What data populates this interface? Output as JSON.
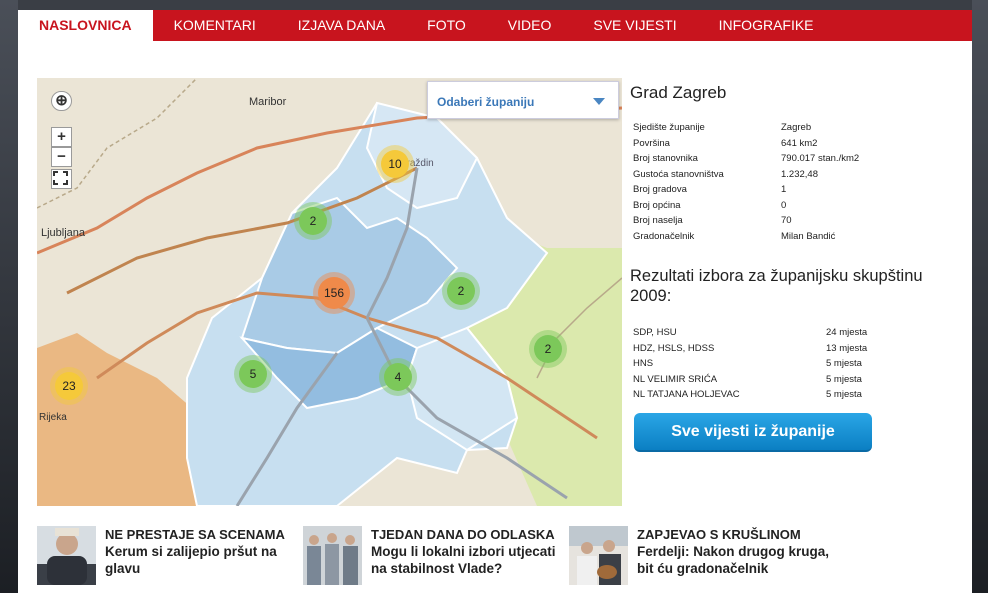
{
  "nav": {
    "tabs": [
      {
        "label": "NASLOVNICA",
        "active": true
      },
      {
        "label": "KOMENTARI"
      },
      {
        "label": "IZJAVA DANA"
      },
      {
        "label": "FOTO"
      },
      {
        "label": "VIDEO"
      },
      {
        "label": "SVE VIJESTI"
      },
      {
        "label": "INFOGRAFIKE"
      }
    ]
  },
  "map": {
    "select_placeholder": "Odaberi županiju",
    "controls": {
      "locate": "⊕",
      "zoom_in": "+",
      "zoom_out": "−"
    },
    "places": [
      "Maribor",
      "Ljubljana",
      "Rijeka",
      "Varaždin"
    ],
    "clusters": [
      {
        "count": "10",
        "color": "#f5c93a"
      },
      {
        "count": "2",
        "color": "#7cc85a"
      },
      {
        "count": "156",
        "color": "#ef8a4a"
      },
      {
        "count": "2",
        "color": "#7cc85a"
      },
      {
        "count": "5",
        "color": "#7cc85a"
      },
      {
        "count": "4",
        "color": "#7cc85a"
      },
      {
        "count": "2",
        "color": "#7cc85a"
      },
      {
        "count": "23",
        "color": "#f5c93a"
      }
    ]
  },
  "county": {
    "title": "Grad Zagreb",
    "facts": [
      {
        "label": "Sjedište županije",
        "value": "Zagreb"
      },
      {
        "label": "Površina",
        "value": "641 km2"
      },
      {
        "label": "Broj stanovnika",
        "value": "790.017 stan./km2"
      },
      {
        "label": "Gustoća stanovništva",
        "value": "1.232,48"
      },
      {
        "label": "Broj gradova",
        "value": "1"
      },
      {
        "label": "Broj općina",
        "value": "0"
      },
      {
        "label": "Broj naselja",
        "value": "70"
      },
      {
        "label": "Gradonačelnik",
        "value": "Milan Bandić"
      }
    ],
    "results_title": "Rezultati izbora za županijsku skupštinu 2009:",
    "results": [
      {
        "party": "SDP, HSU",
        "seats": "24 mjesta"
      },
      {
        "party": "HDZ, HSLS, HDSS",
        "seats": "13 mjesta"
      },
      {
        "party": "HNS",
        "seats": "5 mjesta"
      },
      {
        "party": "NL VELIMIR SRIĆA",
        "seats": "5 mjesta"
      },
      {
        "party": "NL TATJANA HOLJEVAC",
        "seats": "5 mjesta"
      }
    ],
    "news_button": "Sve vijesti iz županije"
  },
  "news": [
    {
      "kicker": "NE PRESTAJE SA SCENAMA",
      "headline": "Kerum si zalijepio pršut na glavu"
    },
    {
      "kicker": "TJEDAN DANA DO ODLASKA",
      "headline": "Mogu li lokalni izbori utjecati na stabilnost Vlade?"
    },
    {
      "kicker": "ZAPJEVAO S KRUŠLINOM",
      "headline": "Ferdelji: Nakon drugog kruga, bit ću gradonačelnik"
    }
  ]
}
